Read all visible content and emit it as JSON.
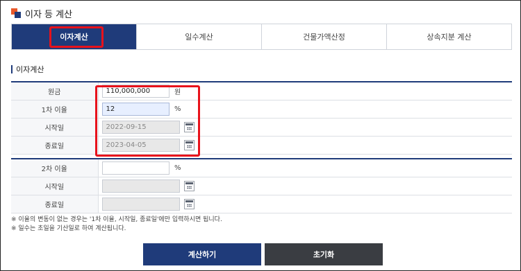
{
  "header": {
    "title": "이자 등 계산"
  },
  "tabs": [
    {
      "label": "이자계산",
      "active": true
    },
    {
      "label": "일수계산",
      "active": false
    },
    {
      "label": "건물가액산정",
      "active": false
    },
    {
      "label": "상속지분 계산",
      "active": false
    }
  ],
  "section": {
    "title": "이자계산"
  },
  "form1": {
    "principal": {
      "label": "원금",
      "value": "110,000,000",
      "unit": "원"
    },
    "rate1": {
      "label": "1차 이율",
      "value": "12",
      "unit": "%"
    },
    "start": {
      "label": "시작일",
      "value": "2022-09-15"
    },
    "end": {
      "label": "종료일",
      "value": "2023-04-05"
    }
  },
  "form2": {
    "rate2": {
      "label": "2차 이율",
      "value": "",
      "unit": "%"
    },
    "start": {
      "label": "시작일",
      "value": ""
    },
    "end": {
      "label": "종료일",
      "value": ""
    }
  },
  "notes": [
    "※ 이율의 변동이 없는 경우는 '1차 이율, 시작일, 종료일'에만 입력하시면 됩니다.",
    "※ 일수는 초일을 기산일로 하여 계산됩니다."
  ],
  "buttons": {
    "calculate": "계산하기",
    "reset": "초기화"
  },
  "colors": {
    "primary": "#1f3b7a",
    "highlight": "#e8121b",
    "dark_button": "#3a3d42",
    "logo_orange": "#e8582a"
  },
  "icons": {
    "date_picker": "calendar-icon",
    "logo": "logo-icon"
  }
}
